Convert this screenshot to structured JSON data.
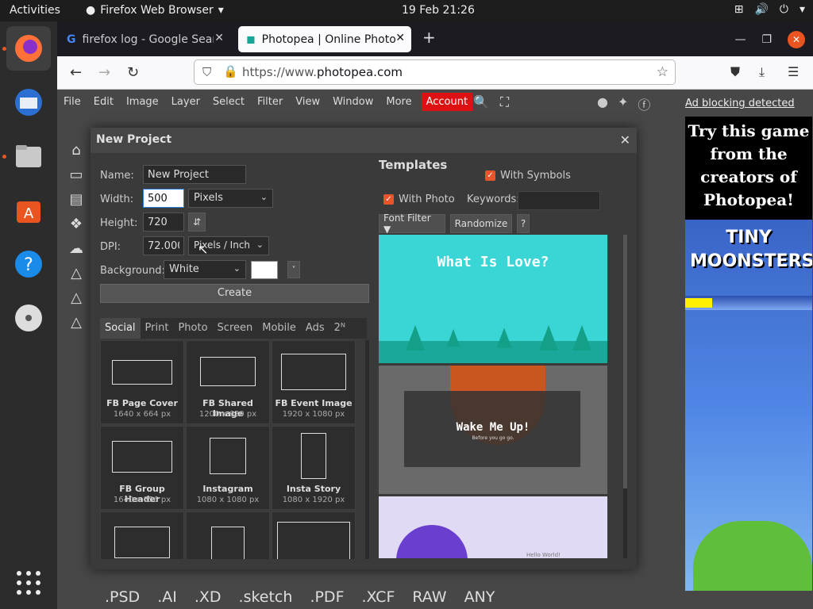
{
  "topbar": {
    "activities": "Activities",
    "app": "Firefox Web Browser",
    "clock": "19 Feb  21:26"
  },
  "browser": {
    "tabs": [
      {
        "label": "firefox log - Google Searc"
      },
      {
        "label": "Photopea | Online Photo"
      }
    ],
    "url_scheme": "https://www.",
    "url_host": "photopea.com"
  },
  "photopea": {
    "menu": [
      "File",
      "Edit",
      "Image",
      "Layer",
      "Select",
      "Filter",
      "View",
      "Window",
      "More"
    ],
    "account": "Account",
    "ad_link": "Ad blocking detected",
    "ad_text": "Try this game from the creators of Photopea!",
    "ad_game_title": "TINY MOONSTERS",
    "drop_formats": [
      ".PSD",
      ".AI",
      ".XD",
      ".sketch",
      ".PDF",
      ".XCF",
      "RAW",
      "ANY"
    ]
  },
  "dialog": {
    "title": "New Project",
    "name_label": "Name:",
    "name_value": "New Project",
    "width_label": "Width:",
    "width_value": "500",
    "width_unit": "Pixels",
    "height_label": "Height:",
    "height_value": "720",
    "dpi_label": "DPI:",
    "dpi_value": "72.000",
    "dpi_unit": "Pixels / Inch",
    "background_label": "Background:",
    "background_value": "White",
    "create": "Create",
    "preset_tabs": [
      "Social",
      "Print",
      "Photo",
      "Screen",
      "Mobile",
      "Ads",
      "2ᴺ"
    ],
    "presets": [
      {
        "name": "FB Page Cover",
        "size": "1640 x 664 px"
      },
      {
        "name": "FB Shared Image",
        "size": "1200 x 630 px"
      },
      {
        "name": "FB Event Image",
        "size": "1920 x 1080 px"
      },
      {
        "name": "FB Group Header",
        "size": "1640 x 856 px"
      },
      {
        "name": "Instagram",
        "size": "1080 x 1080 px"
      },
      {
        "name": "Insta Story",
        "size": "1080 x 1920 px"
      },
      {
        "name": "",
        "size": ""
      },
      {
        "name": "",
        "size": ""
      },
      {
        "name": "",
        "size": ""
      }
    ],
    "templates_title": "Templates",
    "with_symbols": "With Symbols",
    "with_photo": "With Photo",
    "keywords_label": "Keywords:",
    "font_filter": "Font Filter ▼",
    "randomize": "Randomize",
    "help": "?",
    "templates": [
      {
        "title": "What Is Love?"
      },
      {
        "title": "Wake Me Up!",
        "subtitle": "Before you go go."
      },
      {
        "title": "Hello World!"
      }
    ]
  }
}
